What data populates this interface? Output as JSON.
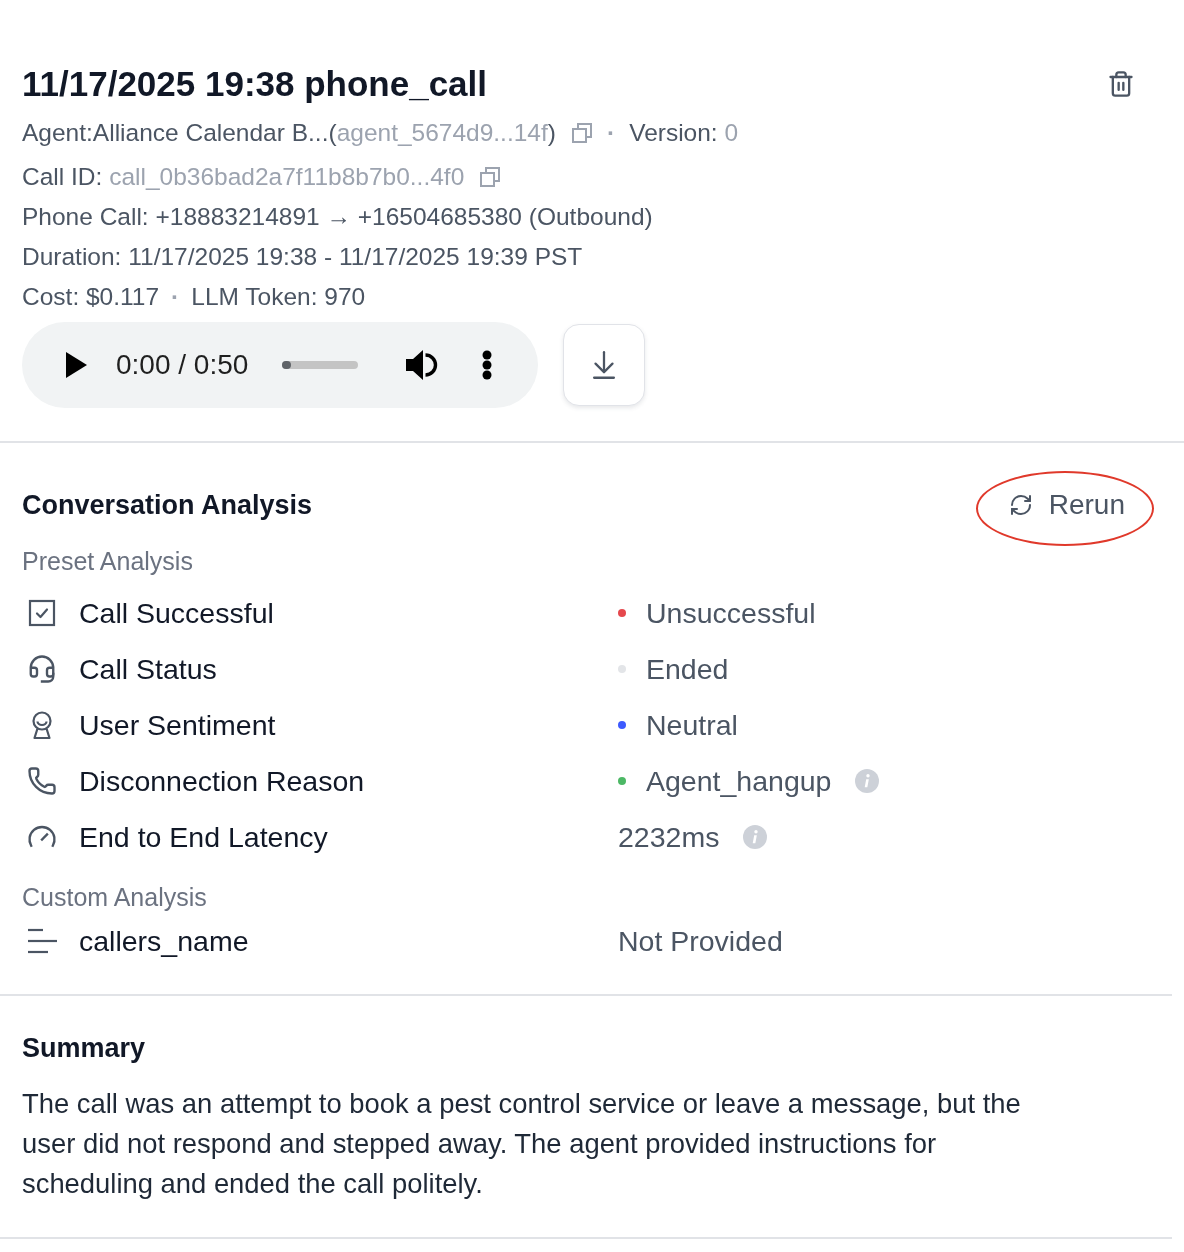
{
  "header": {
    "title": "11/17/2025 19:38 phone_call"
  },
  "meta": {
    "agent": {
      "label": "Agent:",
      "name": "Alliance Calendar B...",
      "brackets": [
        "(",
        ")"
      ],
      "id": "agent_5674d9...14f",
      "separator": "·",
      "version_label": "Version:",
      "version_value": "0"
    },
    "call_id": {
      "label": "Call ID:",
      "value": "call_0b36bad2a7f11b8b7b0...4f0"
    },
    "phone_call": "Phone Call: +18883214891 → +16504685380 (Outbound)",
    "duration": "Duration: 11/17/2025 19:38 - 11/17/2025 19:39 PST",
    "cost": {
      "cost": "Cost: $0.117",
      "separator": "·",
      "tokens": "LLM Token: 970"
    }
  },
  "player": {
    "time": "0:00 / 0:50",
    "level": 0
  },
  "analysis": {
    "title": "Conversation Analysis",
    "rerun": {
      "label": "Rerun",
      "circled": true
    },
    "preset": {
      "label": "Preset Analysis",
      "rows": [
        {
          "kind": "check",
          "label": "Call Successful",
          "value": "Unsuccessful",
          "color": "#e5484d",
          "info": false
        },
        {
          "kind": "headset",
          "label": "Call Status",
          "value": "Ended",
          "color": "#e3e5e8",
          "info": false
        },
        {
          "kind": "sentiment",
          "label": "User Sentiment",
          "value": "Neutral",
          "color": "#3d5afe",
          "info": false
        },
        {
          "kind": "phone",
          "label": "Disconnection Reason",
          "value": "Agent_hangup",
          "color": "#4cb865",
          "info": true
        },
        {
          "kind": "gauge",
          "label": "End to End Latency",
          "value": "2232ms",
          "info": true
        }
      ]
    },
    "custom": {
      "label": "Custom Analysis",
      "rows": [
        {
          "kind": "text",
          "label": "callers_name",
          "value": "Not Provided",
          "info": false
        }
      ]
    }
  },
  "summary": {
    "title": "Summary",
    "text": "The call was an attempt to book a pest control service or leave a message, but the user did not respond and stepped away. The agent provided instructions for scheduling and ended the call politely."
  }
}
